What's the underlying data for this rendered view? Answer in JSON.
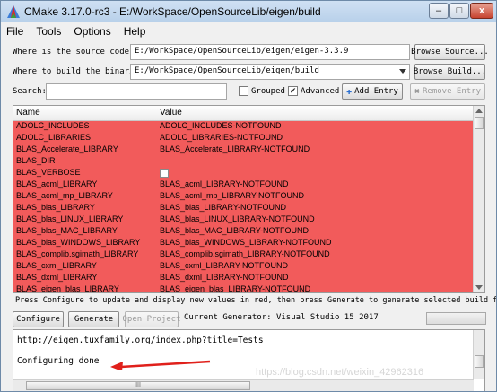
{
  "window": {
    "title": "CMake 3.17.0-rc3 - E:/WorkSpace/OpenSourceLib/eigen/build",
    "min_label": "–",
    "max_label": "□",
    "close_label": "x"
  },
  "menu": [
    "File",
    "Tools",
    "Options",
    "Help"
  ],
  "source": {
    "label": "Where is the source code:",
    "value": "E:/WorkSpace/OpenSourceLib/eigen/eigen-3.3.9",
    "button": "Browse Source..."
  },
  "binaries": {
    "label": "Where to build the binaries:",
    "value": "E:/WorkSpace/OpenSourceLib/eigen/build",
    "button": "Browse Build..."
  },
  "search": {
    "label": "Search:",
    "value": "",
    "grouped_label": "Grouped",
    "grouped_checked": false,
    "advanced_label": "Advanced",
    "advanced_checked": true,
    "add_entry": "Add Entry",
    "remove_entry": "Remove Entry"
  },
  "table": {
    "columns": [
      "Name",
      "Value"
    ],
    "highlight_color": "#f25b5b",
    "rows": [
      {
        "name": "ADOLC_INCLUDES",
        "value": "ADOLC_INCLUDES-NOTFOUND"
      },
      {
        "name": "ADOLC_LIBRARIES",
        "value": "ADOLC_LIBRARIES-NOTFOUND"
      },
      {
        "name": "BLAS_Accelerate_LIBRARY",
        "value": "BLAS_Accelerate_LIBRARY-NOTFOUND"
      },
      {
        "name": "BLAS_DIR",
        "value": ""
      },
      {
        "name": "BLAS_VERBOSE",
        "value": "",
        "checkbox": true
      },
      {
        "name": "BLAS_acml_LIBRARY",
        "value": "BLAS_acml_LIBRARY-NOTFOUND"
      },
      {
        "name": "BLAS_acml_mp_LIBRARY",
        "value": "BLAS_acml_mp_LIBRARY-NOTFOUND"
      },
      {
        "name": "BLAS_blas_LIBRARY",
        "value": "BLAS_blas_LIBRARY-NOTFOUND"
      },
      {
        "name": "BLAS_blas_LINUX_LIBRARY",
        "value": "BLAS_blas_LINUX_LIBRARY-NOTFOUND"
      },
      {
        "name": "BLAS_blas_MAC_LIBRARY",
        "value": "BLAS_blas_MAC_LIBRARY-NOTFOUND"
      },
      {
        "name": "BLAS_blas_WINDOWS_LIBRARY",
        "value": "BLAS_blas_WINDOWS_LIBRARY-NOTFOUND"
      },
      {
        "name": "BLAS_complib.sgimath_LIBRARY",
        "value": "BLAS_complib.sgimath_LIBRARY-NOTFOUND"
      },
      {
        "name": "BLAS_cxml_LIBRARY",
        "value": "BLAS_cxml_LIBRARY-NOTFOUND"
      },
      {
        "name": "BLAS_dxml_LIBRARY",
        "value": "BLAS_dxml_LIBRARY-NOTFOUND"
      },
      {
        "name": "BLAS_eigen_blas_LIBRARY",
        "value": "BLAS_eigen_blas_LIBRARY-NOTFOUND"
      }
    ]
  },
  "info_text": "Press Configure to update and display new values in red, then press Generate to generate selected build files.",
  "actions": {
    "configure": "Configure",
    "generate": "Generate",
    "open_project": "Open Project",
    "generator": "Current Generator: Visual Studio 15 2017"
  },
  "log": {
    "lines": [
      "  http://eigen.tuxfamily.org/index.php?title=Tests",
      "",
      "Configuring done"
    ],
    "hscroll_grip": "III"
  },
  "watermark": "https://blog.csdn.net/weixin_42962316"
}
